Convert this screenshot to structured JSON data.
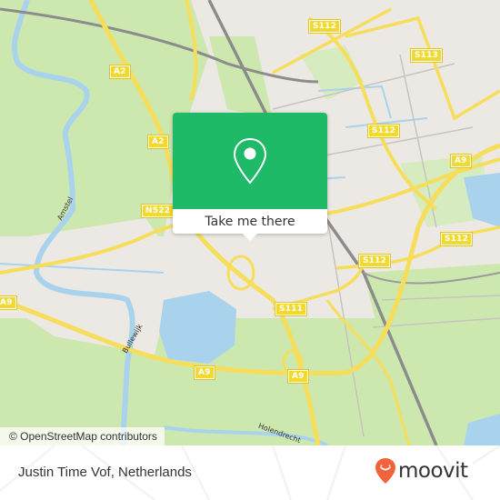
{
  "map": {
    "colors": {
      "land": "#ece8e4",
      "green": "#cde8ae",
      "water": "#a9d3ec",
      "road": "#f6dd5a",
      "rail": "#888888",
      "accent": "#1fba68",
      "brand": "#f1633a"
    },
    "road_shields": [
      {
        "label": "S112"
      },
      {
        "label": "S113"
      },
      {
        "label": "A2"
      },
      {
        "label": "A2"
      },
      {
        "label": "S112"
      },
      {
        "label": "A9"
      },
      {
        "label": "N522"
      },
      {
        "label": "S112"
      },
      {
        "label": "S112"
      },
      {
        "label": "S111"
      },
      {
        "label": "A9"
      },
      {
        "label": "A9"
      },
      {
        "label": "A9"
      }
    ],
    "street_labels": [
      {
        "label": "Amstel"
      },
      {
        "label": "Bullewijk"
      },
      {
        "label": "Holendrecht"
      }
    ],
    "attribution": "© OpenStreetMap contributors"
  },
  "popup": {
    "icon": "location-pin-icon",
    "button_label": "Take me there"
  },
  "footer": {
    "place_name": "Justin Time Vof, Netherlands",
    "brand_name": "moovit",
    "brand_icon": "moovit-pin-logo-icon"
  }
}
